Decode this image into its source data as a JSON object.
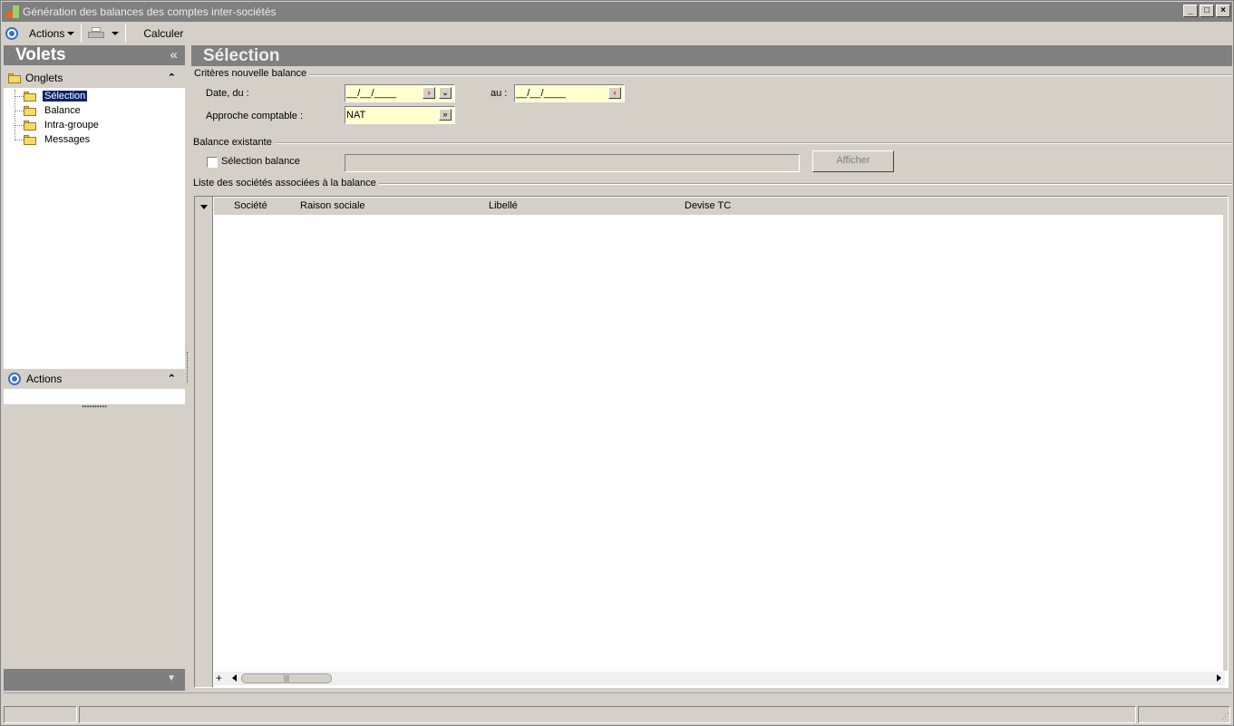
{
  "window": {
    "title": "Génération des balances des comptes inter-sociétés",
    "controls": [
      "minimize",
      "maximize",
      "close"
    ]
  },
  "toolbar": {
    "actions_label": "Actions",
    "calculate_label": "Calculer"
  },
  "left_panel": {
    "header": "Volets",
    "collapse_glyph": "«",
    "tabs_group_label": "Onglets",
    "tree_items": [
      "Sélection",
      "Balance",
      "Intra-groupe",
      "Messages"
    ],
    "selected_index": 0,
    "actions_group_label": "Actions"
  },
  "main": {
    "header": "Sélection",
    "criteria": {
      "section_title": "Critères nouvelle balance",
      "date_from_label": "Date, du :",
      "date_from_value": "__/__/____",
      "date_to_label": "au :",
      "date_to_value": "__/__/____",
      "approach_label": "Approche comptable :",
      "approach_value": "NAT"
    },
    "existing": {
      "section_title": "Balance existante",
      "checkbox_label": "Sélection balance",
      "checked": false,
      "show_button": "Afficher"
    },
    "companies": {
      "section_title": "Liste des sociétés associées à la balance",
      "columns": [
        "Société",
        "Raison sociale",
        "Libellé",
        "Devise TC"
      ],
      "rows": []
    }
  },
  "colors": {
    "header_gray": "#808080",
    "input_yellow": "#ffffd0",
    "selection_blue": "#0a246a",
    "accent_blue": "#3a6fc4"
  }
}
